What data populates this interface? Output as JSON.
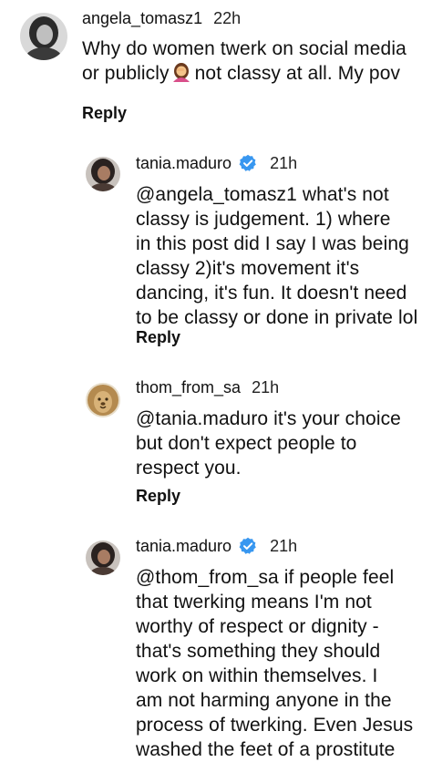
{
  "comments": [
    {
      "username": "angela_tomasz1",
      "time": "22h",
      "verified": false,
      "lines": [
        "Why do women twerk on social media"
      ],
      "line2_before_emoji": "or publicly",
      "emoji": "woman-facepalming",
      "line2_after_emoji": "not classy at all. My pov",
      "reply_label": "Reply"
    },
    {
      "username": "tania.maduro",
      "time": "21h",
      "verified": true,
      "lines": [
        "@angela_tomasz1 what's not",
        "classy is judgement. 1) where",
        "in this post did I say I was being",
        "classy 2)it's movement it's",
        "dancing, it's fun. It doesn't need",
        "to be classy or done in private lol"
      ],
      "reply_label": "Reply"
    },
    {
      "username": "thom_from_sa",
      "time": "21h",
      "verified": false,
      "lines": [
        "@tania.maduro it's your choice",
        "but don't expect people to",
        "respect you."
      ],
      "reply_label": "Reply"
    },
    {
      "username": "tania.maduro",
      "time": "21h",
      "verified": true,
      "lines": [
        "@thom_from_sa if people feel",
        "that twerking means I'm not",
        "worthy of respect or dignity -",
        "that's something they should",
        "work on within themselves. I",
        "am not harming anyone in the",
        "process of twerking. Even Jesus",
        "washed the feet of a prostitute"
      ]
    }
  ],
  "colors": {
    "verified_blue": "#3897f0",
    "text": "#111111",
    "background": "#ffffff"
  }
}
